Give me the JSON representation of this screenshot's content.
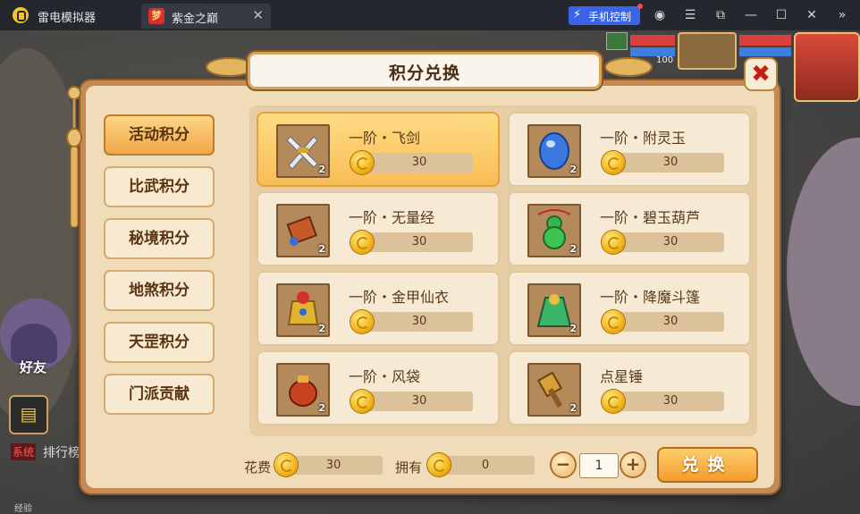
{
  "titlebar": {
    "app_name": "雷电模拟器",
    "tab_title": "紫金之巅",
    "tab_icon_glyph": "梦",
    "phone_control_label": "手机控制"
  },
  "panel": {
    "title": "积分兑换",
    "close_glyph": "✖"
  },
  "tabs": [
    {
      "label": "活动积分",
      "active": true
    },
    {
      "label": "比武积分",
      "active": false
    },
    {
      "label": "秘境积分",
      "active": false
    },
    {
      "label": "地煞积分",
      "active": false
    },
    {
      "label": "天罡积分",
      "active": false
    },
    {
      "label": "门派贡献",
      "active": false
    }
  ],
  "items": [
    {
      "name": "一阶・飞剑",
      "price": "30",
      "count": "2",
      "icon": "sword-icon",
      "selected": true
    },
    {
      "name": "一阶・附灵玉",
      "price": "30",
      "count": "2",
      "icon": "jade-icon",
      "selected": false
    },
    {
      "name": "一阶・无量经",
      "price": "30",
      "count": "2",
      "icon": "scroll-icon",
      "selected": false
    },
    {
      "name": "一阶・碧玉葫芦",
      "price": "30",
      "count": "2",
      "icon": "gourd-icon",
      "selected": false
    },
    {
      "name": "一阶・金甲仙衣",
      "price": "30",
      "count": "2",
      "icon": "armor-icon",
      "selected": false
    },
    {
      "name": "一阶・降魔斗篷",
      "price": "30",
      "count": "2",
      "icon": "cloak-icon",
      "selected": false
    },
    {
      "name": "一阶・风袋",
      "price": "30",
      "count": "2",
      "icon": "wind-bag-icon",
      "selected": false
    },
    {
      "name": "点星锤",
      "price": "30",
      "count": "2",
      "icon": "hammer-icon",
      "selected": false
    }
  ],
  "footer": {
    "cost_label": "花费",
    "cost_value": "30",
    "own_label": "拥有",
    "own_value": "0",
    "minus": "−",
    "plus": "+",
    "quantity": "1",
    "exchange_label": "兑换"
  },
  "hud": {
    "friends_label": "好友",
    "system_tag": "系统",
    "rank_text": "排行榜",
    "hud_number": "100",
    "exp_label": "经验"
  }
}
